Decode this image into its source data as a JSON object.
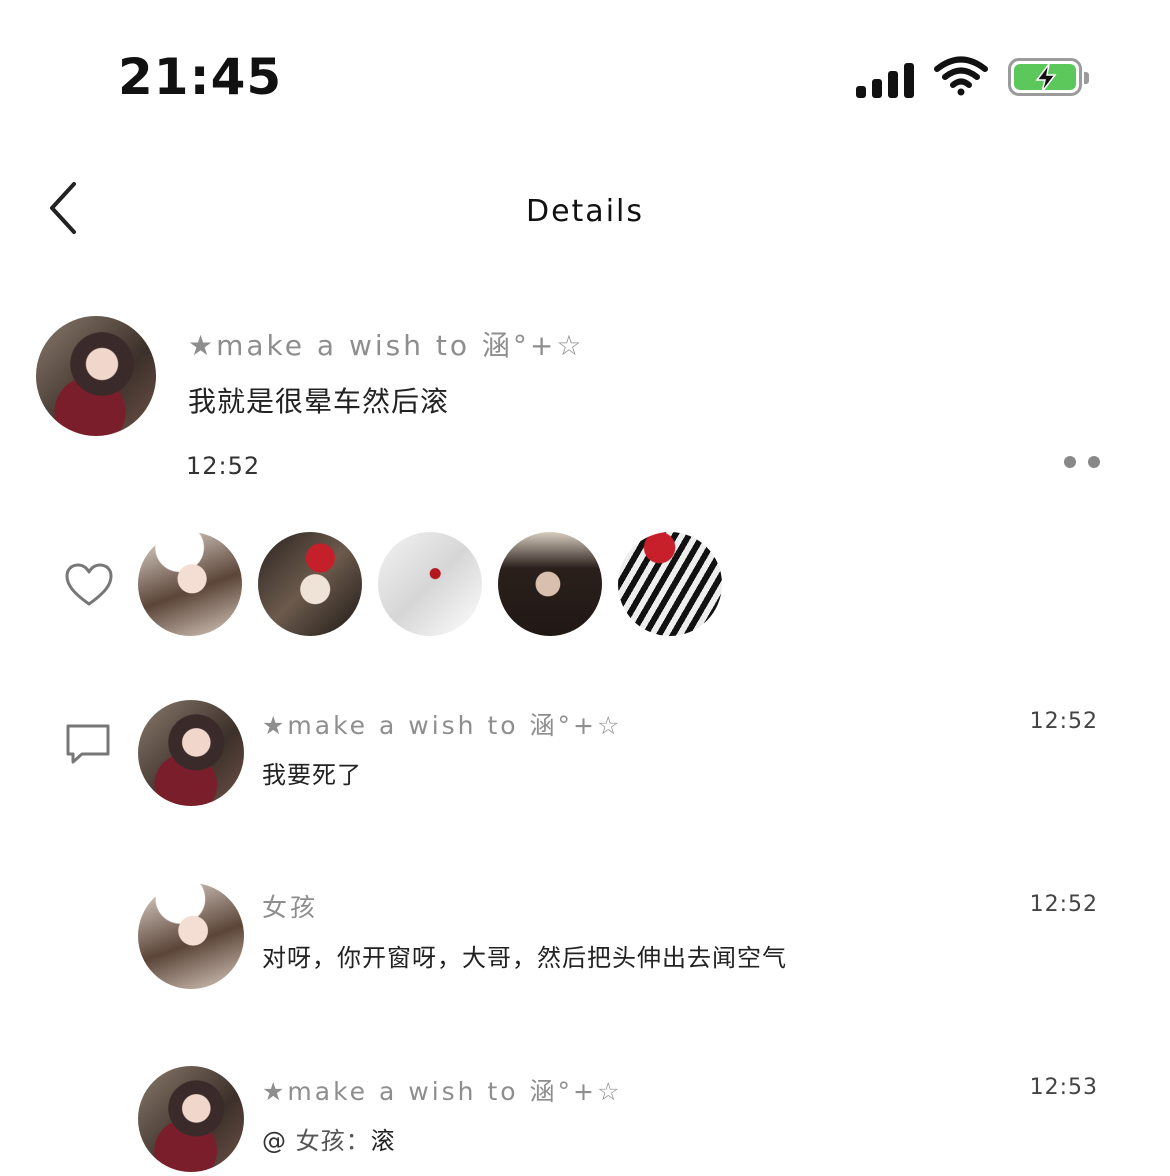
{
  "status_bar": {
    "time": "21:45"
  },
  "nav": {
    "title": "Details"
  },
  "post": {
    "username": "★make a wish to 涵°+☆",
    "text": "我就是很晕车然后滚",
    "time": "12:52"
  },
  "likes": {
    "icon": "heart-icon",
    "count_shown": 5
  },
  "comments": [
    {
      "username": "★make a wish to 涵°+☆",
      "text": "我要死了",
      "time": "12:52"
    },
    {
      "username": "女孩",
      "text": "对呀，你开窗呀，大哥，然后把头伸出去闻空气",
      "time": "12:52"
    },
    {
      "username": "★make a wish to 涵°+☆",
      "mention_at": "@",
      "mention_name": "女孩：",
      "text": "滚",
      "time": "12:53"
    }
  ],
  "colors": {
    "battery": "#5cc75a",
    "muted": "#8e8e8e"
  }
}
